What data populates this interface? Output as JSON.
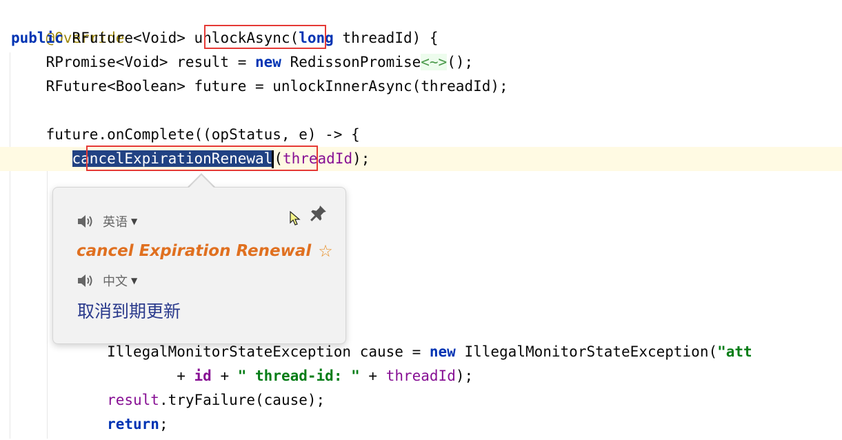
{
  "code": {
    "annotation": "@Override",
    "line_sig": {
      "public": "public",
      "type": " RFuture<Void> ",
      "method": "unlockAsync",
      "open": "(",
      "long": "long",
      "rest": " threadId) {"
    },
    "line_promise": {
      "indent": "    RPromise<Void> result = ",
      "new": "new",
      "type": " RedissonPromise",
      "hint": "<~>",
      "end": "();"
    },
    "line_future": "    RFuture<Boolean> future = unlockInnerAsync(threadId);",
    "line_oncomplete": "    future.onComplete((opStatus, e) -> {",
    "line_cancel": {
      "indent": "       ",
      "selected": "cancelExpirationRenewal",
      "open": "(",
      "arg": "threadId",
      "end": ");"
    },
    "line_exception": {
      "indent": "           IllegalMonitorStateException cause = ",
      "new": "new",
      "rest": " IllegalMonitorStateException(",
      "str": "\"att"
    },
    "line_concat": {
      "indent": "                   + ",
      "id": "id",
      "plus": " + ",
      "str": "\" thread-id: \"",
      "plus2": " + ",
      "arg": "threadId",
      "end": ");"
    },
    "line_tryfailure": {
      "indent": "           ",
      "obj": "result",
      "rest": ".tryFailure(cause);"
    },
    "line_return": {
      "indent": "           ",
      "kw": "return",
      "end": ";"
    }
  },
  "popup": {
    "source_lang": "英语",
    "source_text": "cancel Expiration Renewal",
    "target_lang": "中文",
    "translation": "取消到期更新"
  },
  "icons": [
    "speaker-icon",
    "pin-icon",
    "star-icon",
    "dropdown-icon",
    "mouse-cursor-icon"
  ],
  "colors": {
    "selection": "#214283",
    "keyword": "#0033b3",
    "string": "#067d17",
    "highlight_box": "#e53935",
    "source_word": "#e07020",
    "translation": "#2a3a8c"
  }
}
